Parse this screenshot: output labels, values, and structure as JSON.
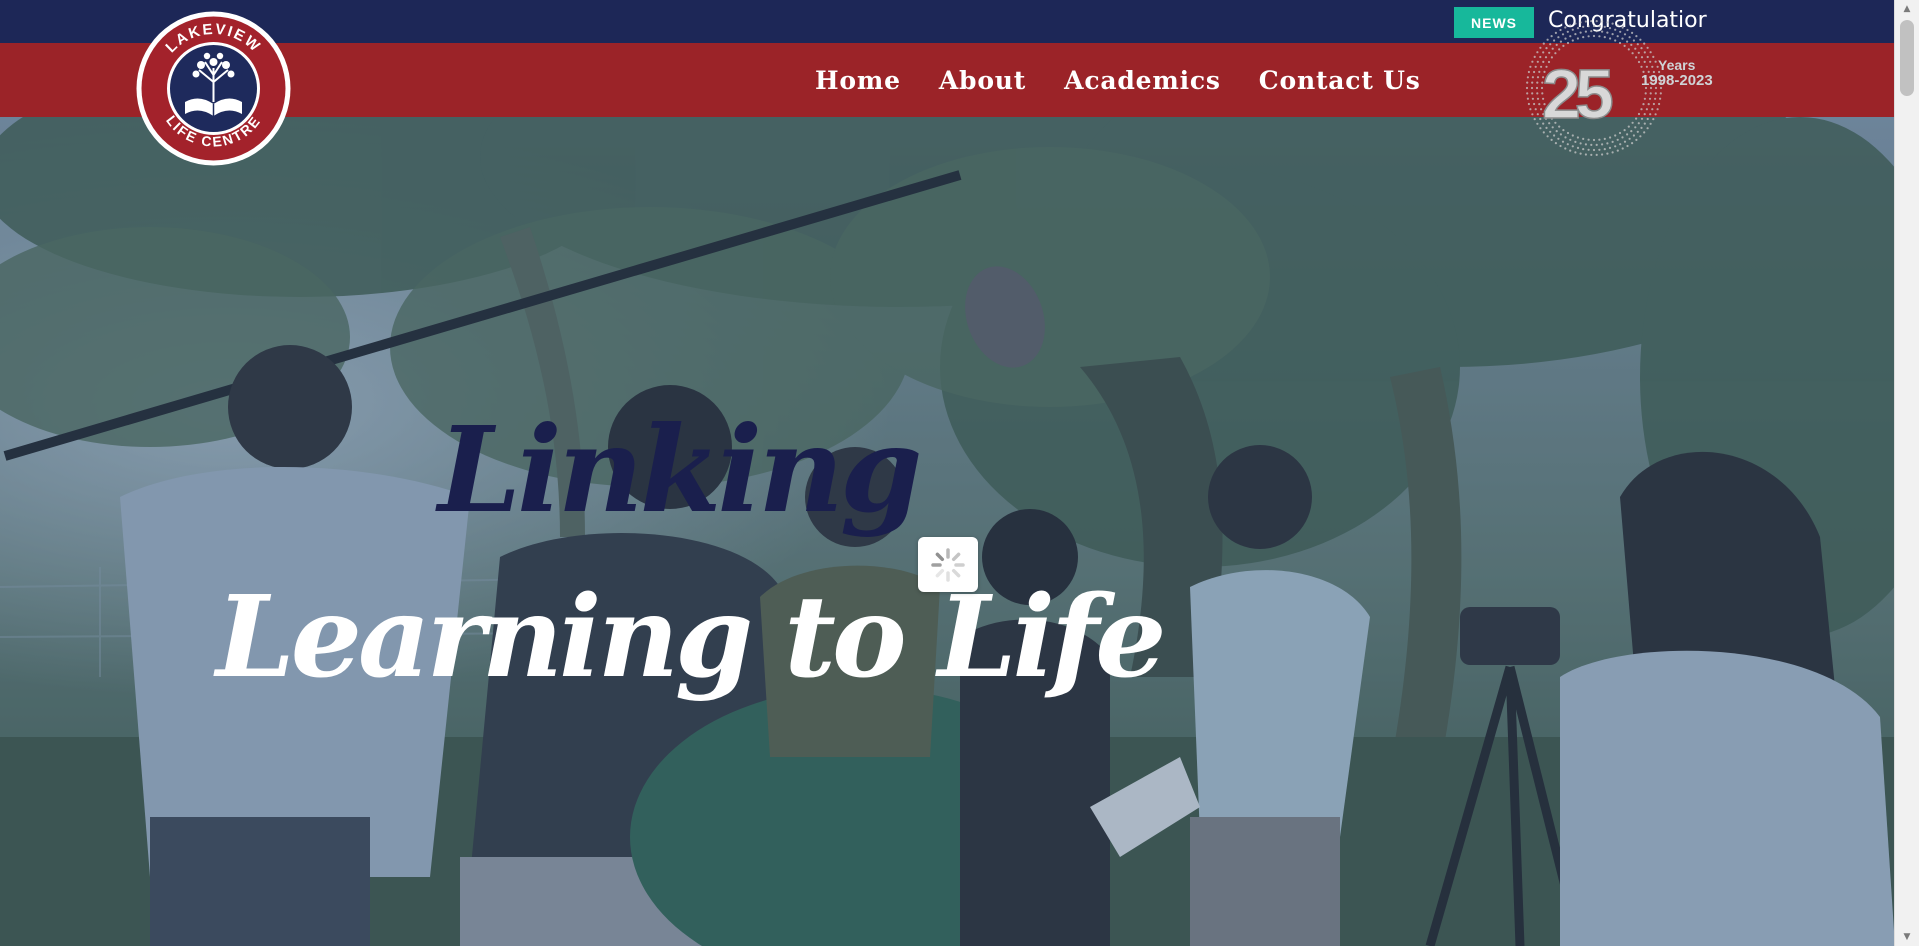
{
  "topbar": {
    "news_label": "NEWS",
    "ticker_text": "Congratulatior"
  },
  "nav": {
    "items": [
      {
        "label": "Home"
      },
      {
        "label": "About"
      },
      {
        "label": "Academics"
      },
      {
        "label": "Contact Us"
      }
    ]
  },
  "logo": {
    "text_top": "LAKEVIEW",
    "text_bottom": "LIFE CENTRE"
  },
  "anniversary": {
    "number": "25",
    "years_label": "Years",
    "range": "1998-2023"
  },
  "hero": {
    "line1": "Linking",
    "line2": "Learning to Life"
  },
  "colors": {
    "topbar": "#1d2757",
    "navbar": "#9b2328",
    "news_badge": "#17b89b",
    "headline_dark": "#1a1f4d",
    "headline_light": "#ffffff"
  },
  "icons": {
    "logo": "book-tree-emblem",
    "loading": "spinner-icon",
    "scroll_up": "chevron-up-icon",
    "scroll_down": "chevron-down-icon"
  }
}
